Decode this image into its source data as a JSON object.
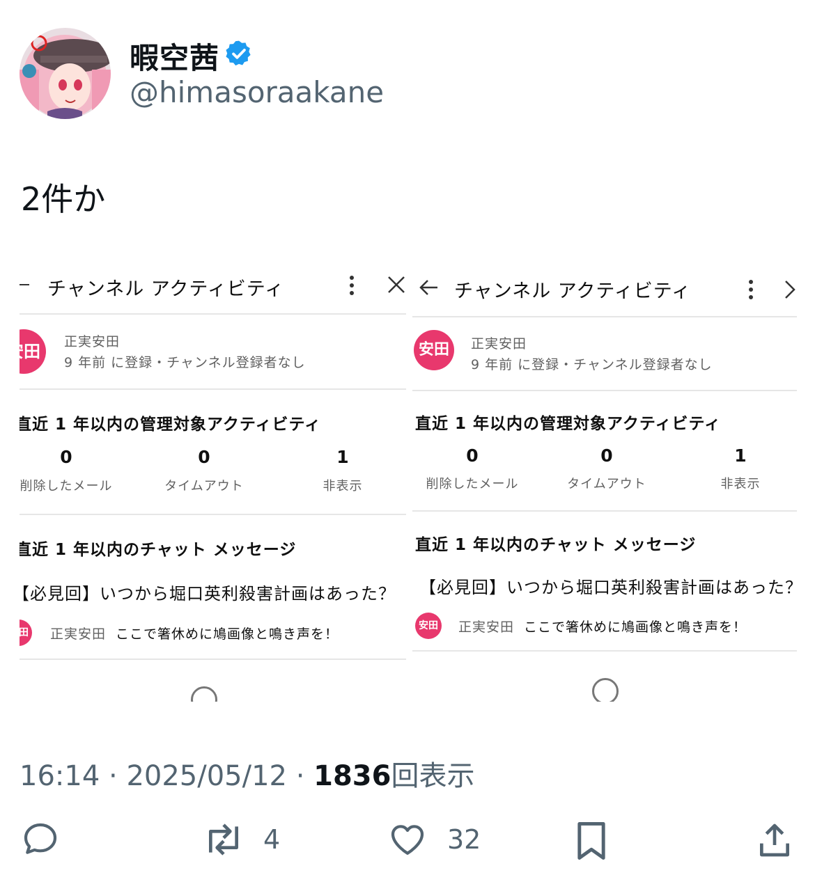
{
  "author": {
    "display_name": "暇空茜",
    "handle": "@himasoraakane",
    "verified": true,
    "avatar_icon": "anime-girl-avatar"
  },
  "tweet": {
    "text": "2件か"
  },
  "screenshot_left": {
    "title": "チャンネル アクティビティ",
    "badge": "安田",
    "user_name": "正実安田",
    "user_sub": "9 年前 に登録・チャンネル登録者なし",
    "section_moderation": "直近 1 年以内の管理対象アクティビティ",
    "stats": [
      {
        "value": "0",
        "label": "削除したメール"
      },
      {
        "value": "0",
        "label": "タイムアウト"
      },
      {
        "value": "1",
        "label": "非表示"
      }
    ],
    "section_chat": "直近 1 年以内のチャット メッセージ",
    "stream_title": "【必見回】いつから堀口英利殺害計画はあった？",
    "chat_badge": "安田",
    "chat_name": "正実安田",
    "chat_text": "ここで箸休めに鳩画像と鳴き声を！"
  },
  "screenshot_right": {
    "title": "チャンネル アクティビティ",
    "badge": "安田",
    "user_name": "正実安田",
    "user_sub": "9 年前 に登録・チャンネル登録者なし",
    "section_moderation": "直近 1 年以内の管理対象アクティビティ",
    "stats": [
      {
        "value": "0",
        "label": "削除したメール"
      },
      {
        "value": "0",
        "label": "タイムアウト"
      },
      {
        "value": "1",
        "label": "非表示"
      }
    ],
    "section_chat": "直近 1 年以内のチャット メッセージ",
    "stream_title": "【必見回】いつから堀口英利殺害計画はあった？",
    "chat_badge": "安田",
    "chat_name": "正実安田",
    "chat_text": "ここで箸休めに鳩画像と鳴き声を！"
  },
  "meta": {
    "time": "16:14",
    "date": "2025/05/12",
    "views": "1836",
    "views_label": "回表示"
  },
  "actions": {
    "reply_count": "",
    "retweet_count": "4",
    "like_count": "32"
  },
  "colors": {
    "verified": "#1d9bf0",
    "badge": "#e8386d",
    "muted": "#536471"
  }
}
